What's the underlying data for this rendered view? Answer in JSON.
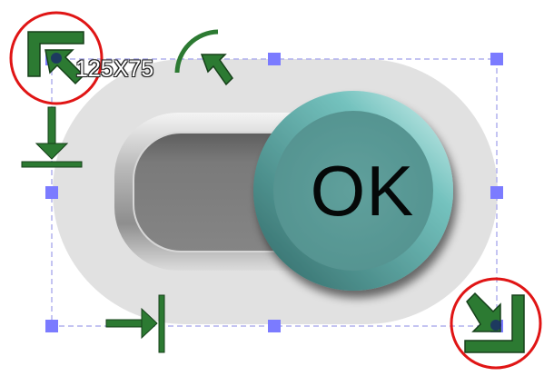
{
  "selection": {
    "size_label": "125X75"
  },
  "toggle": {
    "button_label": "OK",
    "state": "on"
  },
  "icons": {
    "top_left_resize": "resize-top-left-icon",
    "rotate": "rotate-icon",
    "move_down": "move-down-icon",
    "move_right": "move-right-icon",
    "bottom_right_resize": "resize-bottom-right-icon"
  },
  "colors": {
    "handle": "#7b7bff",
    "selection_border": "#b0b0ee",
    "guide_green": "#2c7a32",
    "highlight_circle": "#e01515",
    "knob_teal": "#5a9c98",
    "track_background": "#e1e1e1"
  }
}
